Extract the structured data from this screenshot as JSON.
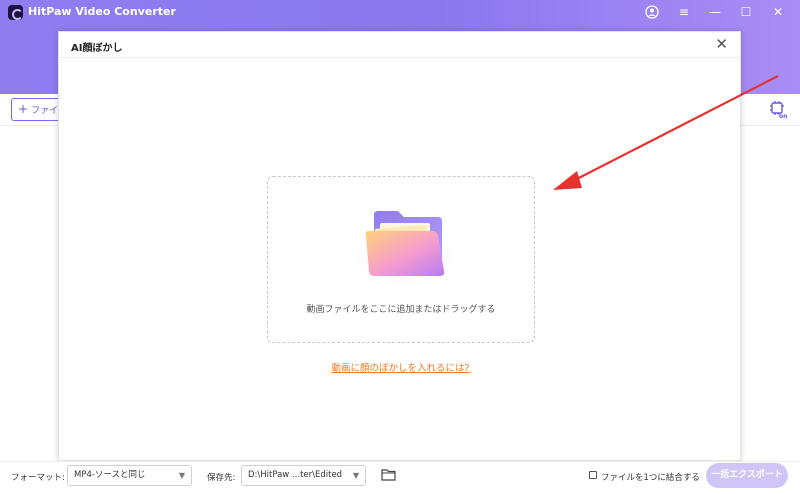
{
  "app": {
    "title": "HitPaw Video Converter"
  },
  "window_controls": {
    "account": "account-icon",
    "menu": "≡",
    "minimize": "—",
    "maximize": "☐",
    "close": "✕"
  },
  "toolbar": {
    "add_file_label": "ファイル"
  },
  "dialog": {
    "title": "AI顔ぼかし",
    "dropzone_text": "動画ファイルをここに追加またはドラッグする",
    "help_link": "動画に顔のぼかしを入れるには?"
  },
  "footer": {
    "format_label": "フォーマット:",
    "format_value": "MP4-ソースと同じ",
    "save_label": "保存先:",
    "save_path": "D:\\HitPaw ...ter\\Edited",
    "merge_label": "ファイルを1つに結合する",
    "export_label": "一括エクスポート"
  },
  "colors": {
    "header": "#8f7df0",
    "accent": "#6a56e0",
    "link": "#f07a2a",
    "arrow": "#e5322d",
    "export_disabled": "#cfc6f7"
  }
}
